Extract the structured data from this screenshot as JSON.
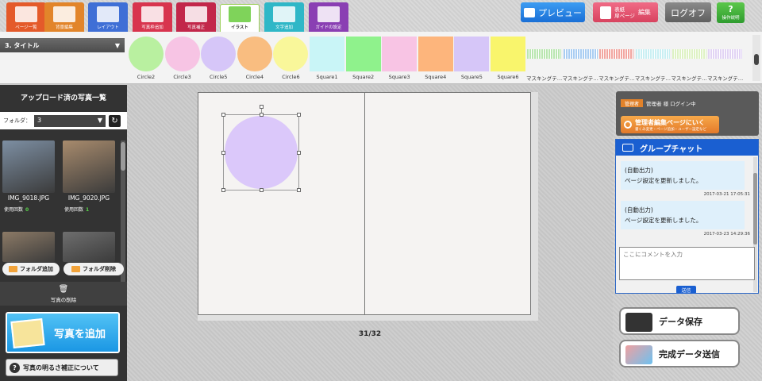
{
  "toolbar": {
    "tabs": [
      {
        "label": "ページ一覧",
        "color": "#e45a2a"
      },
      {
        "label": "背景編集",
        "color": "#e2852a"
      },
      {
        "label": "レイアウト",
        "color": "#3f6fd6"
      },
      {
        "label": "写真枠追加",
        "color": "#d8344e"
      },
      {
        "label": "写真補正",
        "color": "#c2274a"
      },
      {
        "label": "イラスト",
        "color": "#ffffff"
      },
      {
        "label": "文字追加",
        "color": "#2fb7c7"
      },
      {
        "label": "ガイドの設定",
        "color": "#8a3fb3"
      }
    ],
    "preview_label": "プレビュー",
    "cover_label_1": "表紙",
    "cover_label_2": "扉ページ",
    "cover_edit_label": "編集",
    "logout_label": "ログオフ",
    "help_label": "操作説明"
  },
  "category": {
    "selected": "3. タイトル"
  },
  "palette": {
    "items": [
      {
        "label": "Circle2",
        "shape": "circle",
        "color": "#b9f0a0"
      },
      {
        "label": "Circle3",
        "shape": "circle",
        "color": "#f7c4e4"
      },
      {
        "label": "Circle5",
        "shape": "circle",
        "color": "#d6c6f8"
      },
      {
        "label": "Circle4",
        "shape": "circle",
        "color": "#f9bd80"
      },
      {
        "label": "Circle6",
        "shape": "circle",
        "color": "#f9f79a"
      },
      {
        "label": "Square1",
        "shape": "square",
        "color": "#c9f5f7"
      },
      {
        "label": "Square2",
        "shape": "square",
        "color": "#8ff28c"
      },
      {
        "label": "Square3",
        "shape": "square",
        "color": "#f8c4e4"
      },
      {
        "label": "Square4",
        "shape": "square",
        "color": "#fdb57c"
      },
      {
        "label": "Square5",
        "shape": "square",
        "color": "#d6c6f8"
      },
      {
        "label": "Square6",
        "shape": "square",
        "color": "#f9f56c"
      },
      {
        "label": "マスキングテ…",
        "shape": "tape",
        "color": "#b9e6b0"
      },
      {
        "label": "マスキングテ…",
        "shape": "tape",
        "color": "#a9cdf2"
      },
      {
        "label": "マスキングテ…",
        "shape": "tape",
        "color": "#f2a6a0"
      },
      {
        "label": "マスキングテ…",
        "shape": "tape",
        "color": "#c9eff3"
      },
      {
        "label": "マスキングテ…",
        "shape": "tape",
        "color": "#def2c4"
      },
      {
        "label": "マスキングテ…",
        "shape": "tape",
        "color": "#e2d4f4"
      }
    ]
  },
  "left_panel": {
    "title": "アップロード済の写真一覧",
    "folder_label": "フォルダ：",
    "folder_value": "3",
    "photos": [
      {
        "name": "IMG_9018.JPG",
        "uses_label": "使用回数",
        "uses": "0",
        "color": "#7d8fa3"
      },
      {
        "name": "IMG_9020.JPG",
        "uses_label": "使用回数",
        "uses": "1",
        "color": "#a88b6d"
      },
      {
        "name": "",
        "uses_label": "",
        "uses": "",
        "color": "#8c7a66"
      },
      {
        "name": "",
        "uses_label": "",
        "uses": "",
        "color": "#6e6e6e"
      }
    ],
    "folder_add_label": "フォルダ追加",
    "folder_delete_label": "フォルダ削除",
    "delete_photo_label": "写真の削除",
    "add_photo_label": "写真を追加",
    "brightness_label": "写真の明るさ補正について"
  },
  "canvas": {
    "page_number": "31/32",
    "selected_shape_color": "#dbc8fa"
  },
  "right_panel": {
    "admin_badge": "管理者",
    "admin_login": "管理者 様 ログイン中",
    "admin_edit_label": "管理者編集ページにいく",
    "admin_edit_sub": "書くみ変更・ページ追加・ユーザー設定など",
    "chat_title": "グループチャット",
    "messages": [
      {
        "line1": "(自動出力)",
        "line2": "ページ設定を更新しました。",
        "time": "2017-03-21 17:05:31"
      },
      {
        "line1": "(自動出力)",
        "line2": "ページ設定を更新しました。",
        "time": "2017-03-23 14:29:36"
      }
    ],
    "comment_placeholder": "ここにコメントを入力",
    "send_label": "送信",
    "save_label": "データ保存",
    "submit_label": "完成データ送信"
  }
}
